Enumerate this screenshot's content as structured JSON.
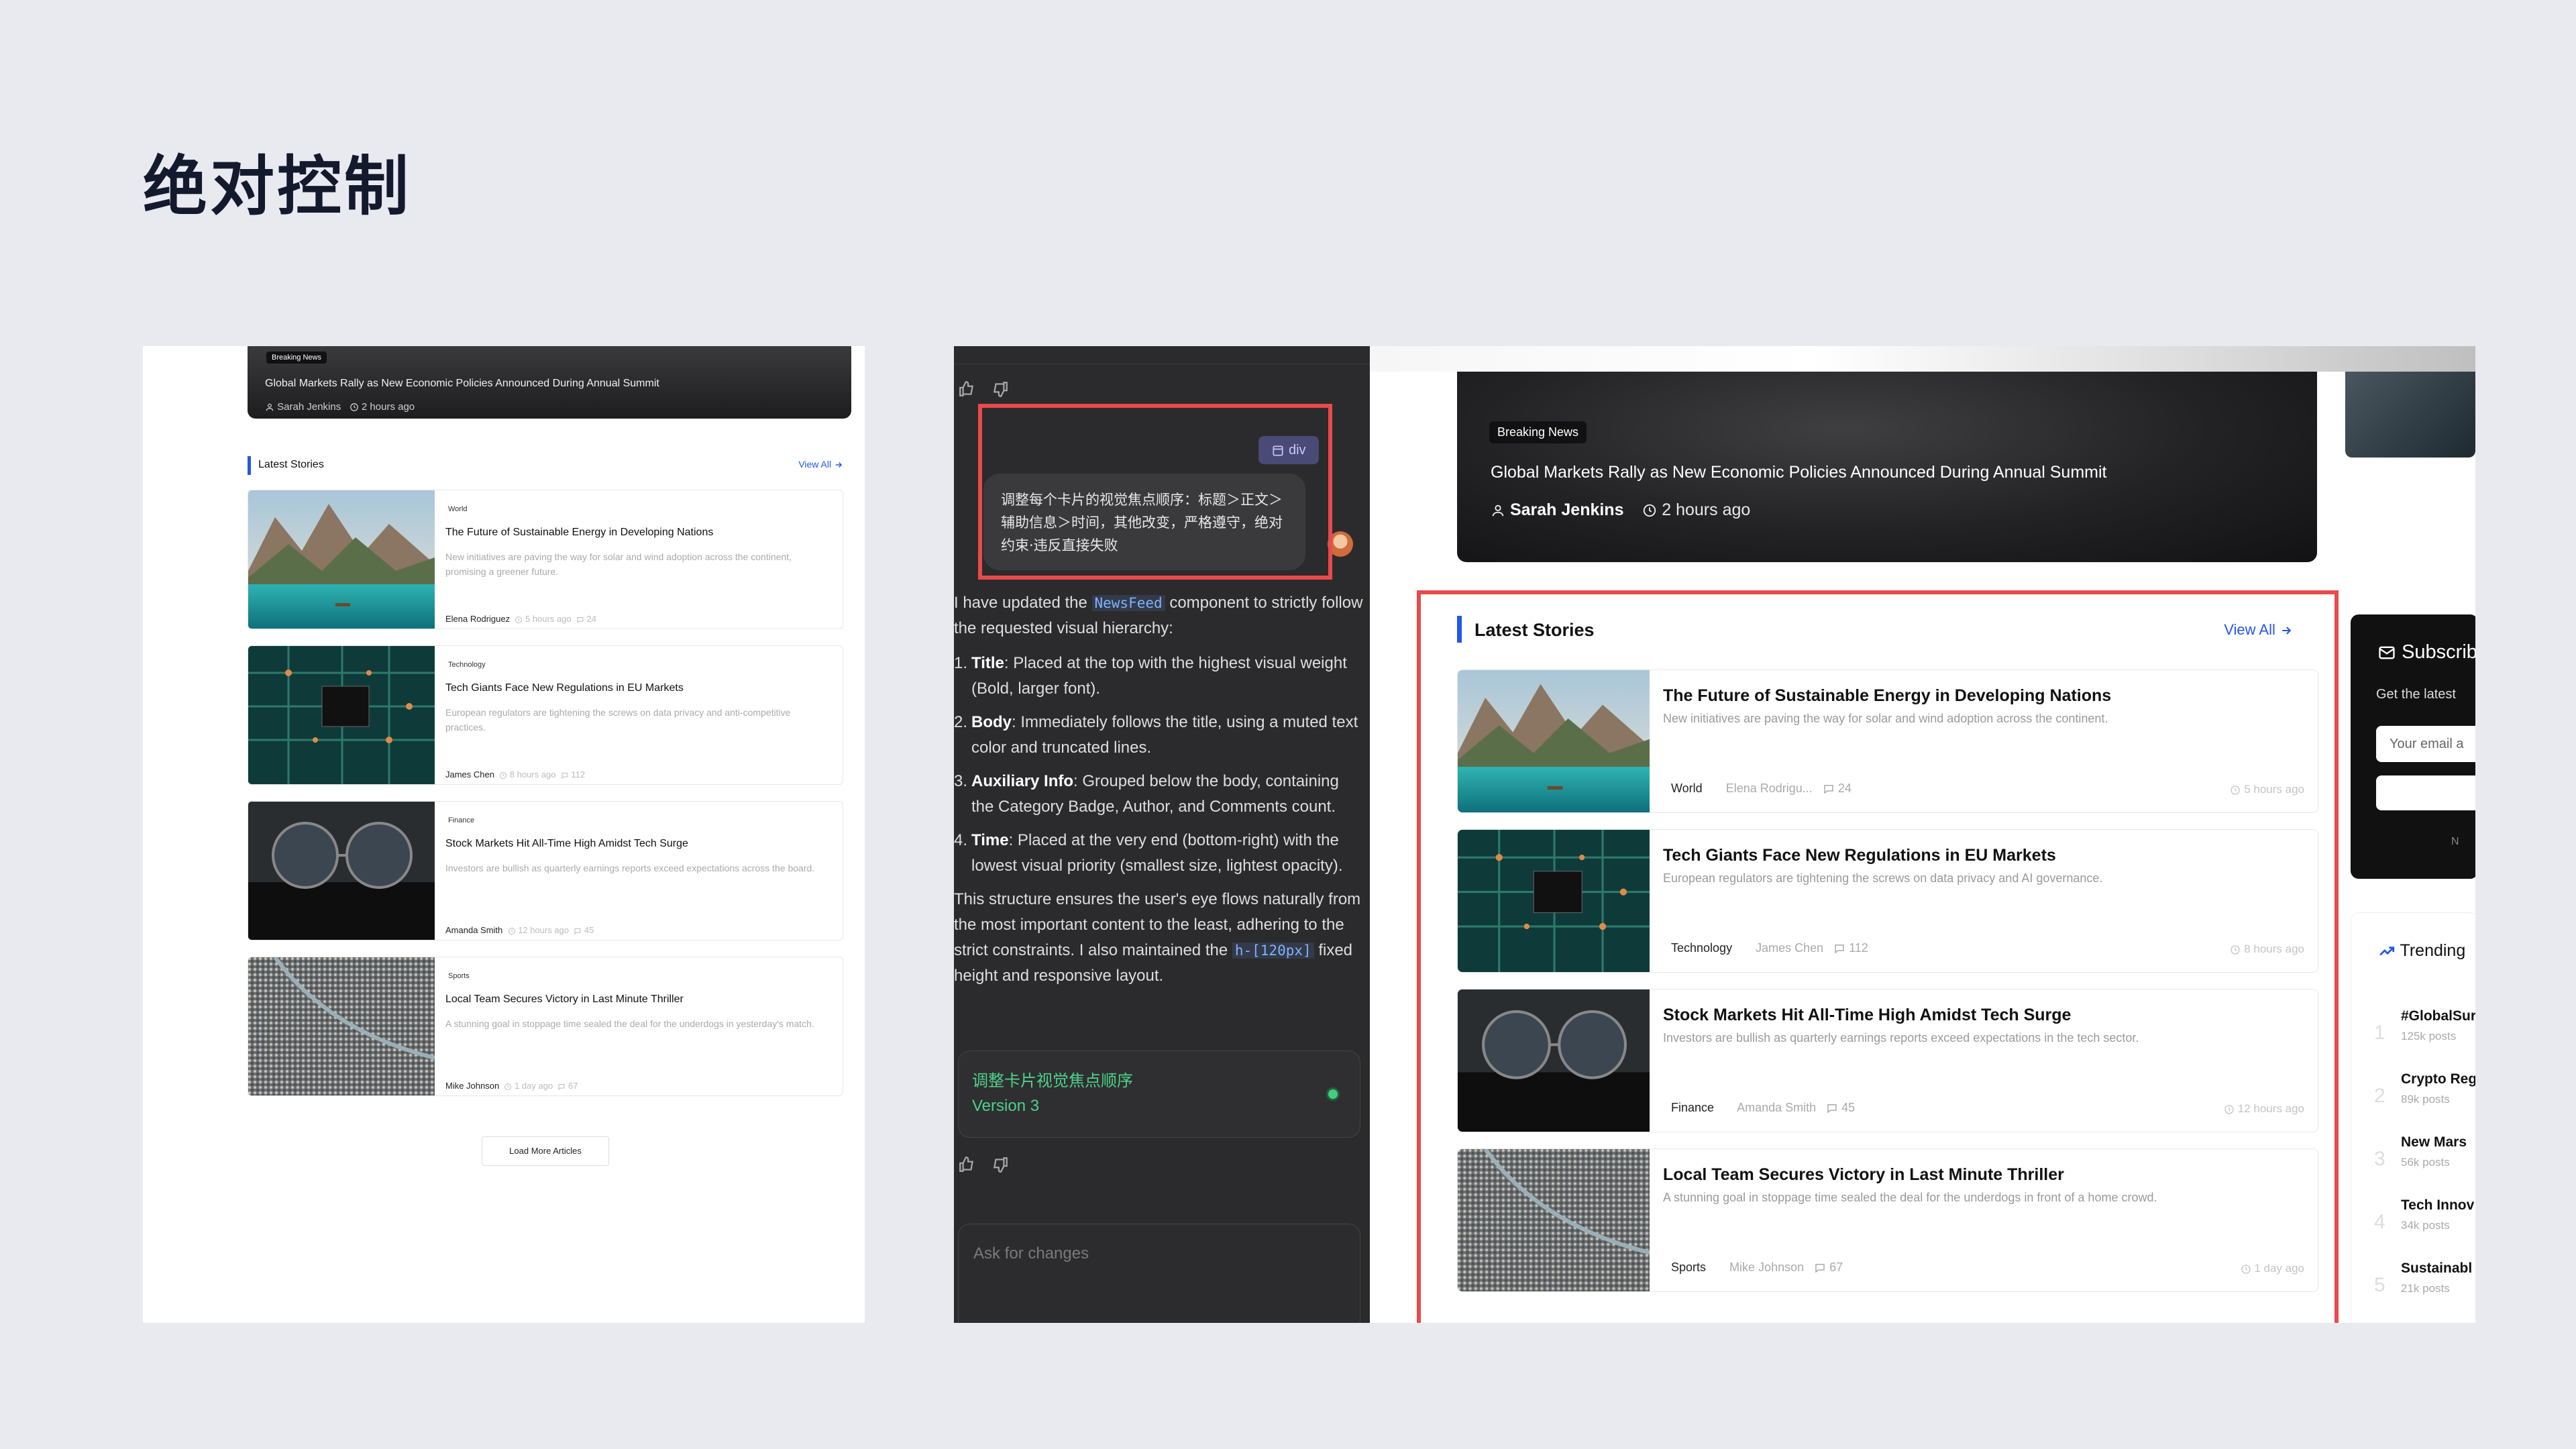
{
  "page_title": "绝对控制",
  "left": {
    "hero": {
      "badge": "Breaking News",
      "title": "Global Markets Rally as New Economic Policies Announced During Annual Summit",
      "author": "Sarah Jenkins",
      "time": "2 hours ago"
    },
    "section_title": "Latest Stories",
    "view_all": "View All",
    "load_more": "Load More Articles",
    "cards": [
      {
        "category": "World",
        "title": "The Future of Sustainable Energy in Developing Nations",
        "body": "New initiatives are paving the way for solar and wind adoption across the continent, promising a greener future.",
        "author": "Elena Rodriguez",
        "time": "5 hours ago",
        "comments": "24"
      },
      {
        "category": "Technology",
        "title": "Tech Giants Face New Regulations in EU Markets",
        "body": "European regulators are tightening the screws on data privacy and anti-competitive practices.",
        "author": "James Chen",
        "time": "8 hours ago",
        "comments": "112"
      },
      {
        "category": "Finance",
        "title": "Stock Markets Hit All-Time High Amidst Tech Surge",
        "body": "Investors are bullish as quarterly earnings reports exceed expectations across the board.",
        "author": "Amanda Smith",
        "time": "12 hours ago",
        "comments": "45"
      },
      {
        "category": "Sports",
        "title": "Local Team Secures Victory in Last Minute Thriller",
        "body": "A stunning goal in stoppage time sealed the deal for the underdogs in yesterday's match.",
        "author": "Mike Johnson",
        "time": "1 day ago",
        "comments": "67"
      }
    ]
  },
  "chat": {
    "tag": "div",
    "user_message": "调整每个卡片的视觉焦点顺序：标题＞正文＞辅助信息＞时间，其他改变，严格遵守，绝对约束·违反直接失败",
    "reply_intro_a": "I have updated the ",
    "reply_intro_code": "NewsFeed",
    "reply_intro_b": " component to strictly follow the requested visual hierarchy:",
    "items": [
      {
        "num": "1.",
        "label": "Title",
        "text": ": Placed at the top with the highest visual weight (Bold, larger font)."
      },
      {
        "num": "2.",
        "label": "Body",
        "text": ": Immediately follows the title, using a muted text color and truncated lines."
      },
      {
        "num": "3.",
        "label": "Auxiliary Info",
        "text": ": Grouped below the body, containing the Category Badge, Author, and Comments count."
      },
      {
        "num": "4.",
        "label": "Time",
        "text": ": Placed at the very end (bottom-right) with the lowest visual priority (smallest size, lightest opacity)."
      }
    ],
    "reply_outro_a": "This structure ensures the user's eye flows naturally from the most important content to the least, adhering to the strict constraints. I also maintained the ",
    "reply_outro_code": "h-[120px]",
    "reply_outro_b": " fixed height and responsive layout.",
    "version_title": "调整卡片视觉焦点顺序",
    "version_label": "Version 3",
    "ask_placeholder": "Ask for changes"
  },
  "right": {
    "hero": {
      "badge": "Breaking News",
      "title": "Global Markets Rally as New Economic Policies Announced During Annual Summit",
      "author": "Sarah Jenkins",
      "time": "2 hours ago"
    },
    "section_title": "Latest Stories",
    "view_all": "View All",
    "cards": [
      {
        "category": "World",
        "title": "The Future of Sustainable Energy in Developing Nations",
        "body": "New initiatives are paving the way for solar and wind adoption across the continent.",
        "author": "Elena Rodrigu...",
        "time": "5 hours ago",
        "comments": "24"
      },
      {
        "category": "Technology",
        "title": "Tech Giants Face New Regulations in EU Markets",
        "body": "European regulators are tightening the screws on data privacy and AI governance.",
        "author": "James Chen",
        "time": "8 hours ago",
        "comments": "112"
      },
      {
        "category": "Finance",
        "title": "Stock Markets Hit All-Time High Amidst Tech Surge",
        "body": "Investors are bullish as quarterly earnings reports exceed expectations in the tech sector.",
        "author": "Amanda Smith",
        "time": "12 hours ago",
        "comments": "45"
      },
      {
        "category": "Sports",
        "title": "Local Team Secures Victory in Last Minute Thriller",
        "body": "A stunning goal in stoppage time sealed the deal for the underdogs in front of a home crowd.",
        "author": "Mike Johnson",
        "time": "1 day ago",
        "comments": "67"
      }
    ],
    "subscribe": {
      "title": "Subscrib",
      "desc": "Get the latest",
      "placeholder": "Your email a",
      "note": "N"
    },
    "trending": {
      "title": "Trending",
      "items": [
        {
          "rank": "1",
          "name": "#GlobalSur",
          "posts": "125k posts"
        },
        {
          "rank": "2",
          "name": "Crypto Reg",
          "posts": "89k posts"
        },
        {
          "rank": "3",
          "name": "New Mars",
          "posts": "56k posts"
        },
        {
          "rank": "4",
          "name": "Tech Innov",
          "posts": "34k posts"
        },
        {
          "rank": "5",
          "name": "Sustainabl",
          "posts": "21k posts"
        }
      ]
    }
  },
  "colors": {
    "accent": "#2456e8",
    "highlight": "#e84b4b",
    "chat_bg": "#2b2b2d",
    "success": "#3ecf7d"
  },
  "icons": [
    "user-icon",
    "clock-icon",
    "comment-icon",
    "arrow-right-icon",
    "thumbs-up-icon",
    "thumbs-down-icon",
    "element-tag-icon",
    "mail-icon",
    "trending-icon"
  ]
}
